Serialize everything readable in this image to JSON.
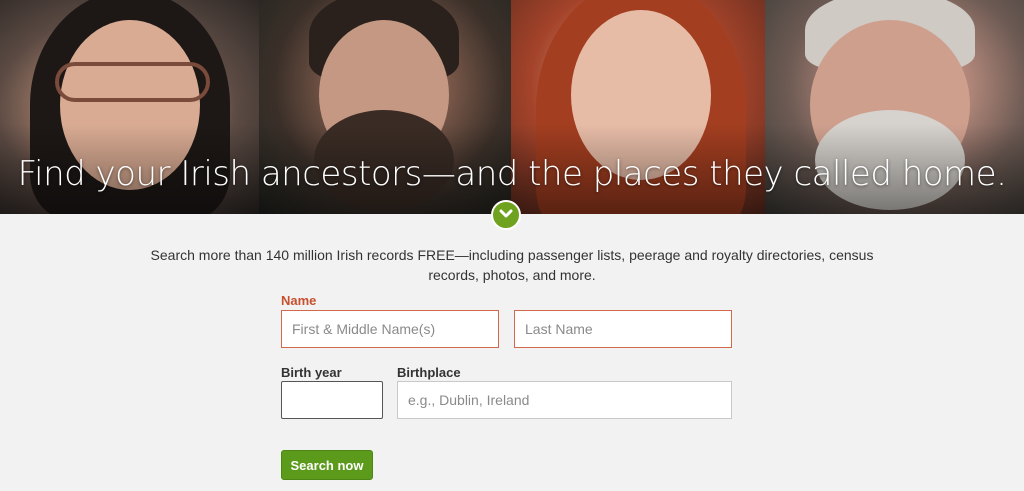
{
  "hero": {
    "headline": "Find your Irish ancestors—and the places they called home."
  },
  "icons": {
    "scroll_down": "chevron-down-icon"
  },
  "colors": {
    "accent_green": "#5c9a1b",
    "error_red": "#c8502f"
  },
  "intro": {
    "description": "Search more than 140 million Irish records FREE—including passenger lists, peerage and royalty directories, census records, photos, and more."
  },
  "form": {
    "name_label": "Name",
    "first_name_placeholder": "First & Middle Name(s)",
    "last_name_placeholder": "Last Name",
    "birth_year_label": "Birth year",
    "birth_year_value": "",
    "birthplace_label": "Birthplace",
    "birthplace_placeholder": "e.g., Dublin, Ireland",
    "search_button": "Search now"
  }
}
